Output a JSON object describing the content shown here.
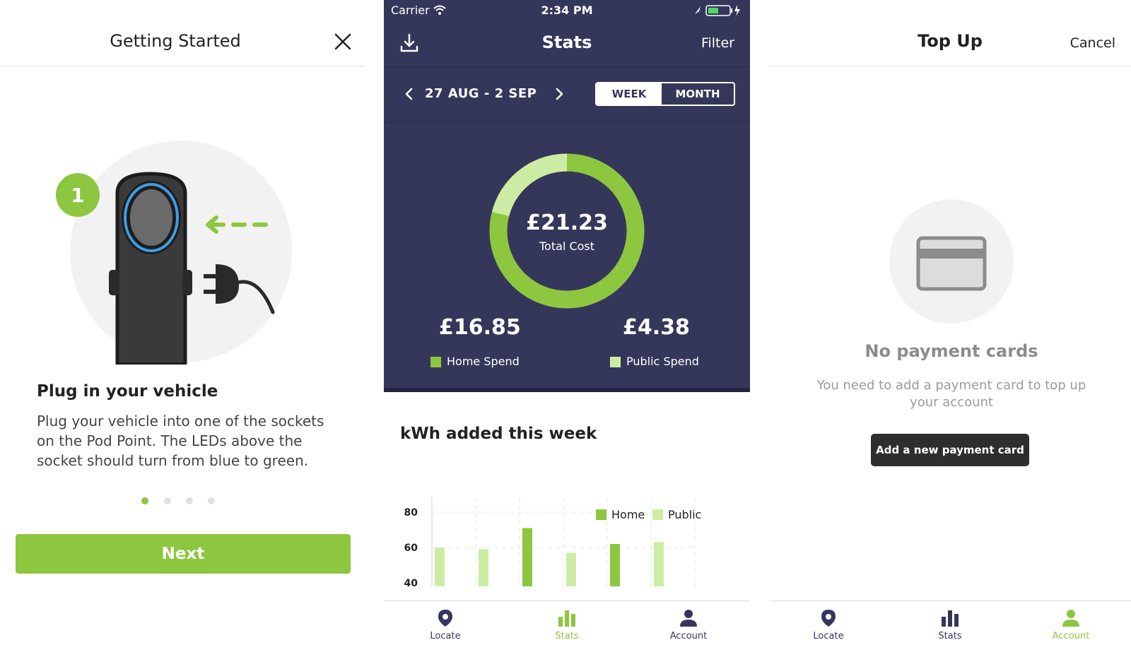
{
  "colors": {
    "brand_green": "#8dc63f",
    "light_green": "#cdeca3",
    "navy": "#35375a",
    "dark_button": "#2e2e2e"
  },
  "getting_started": {
    "title": "Getting Started",
    "close_icon": "close-icon",
    "step_badge": "1",
    "step_title": "Plug in your vehicle",
    "step_body": "Plug your vehicle into one of the sockets on the Pod Point. The LEDs above the socket should turn from blue to green.",
    "pager": {
      "count": 4,
      "active": 0
    },
    "next_label": "Next"
  },
  "stats": {
    "status_bar": {
      "carrier": "Carrier",
      "time": "2:34 PM"
    },
    "title": "Stats",
    "filter_label": "Filter",
    "date_range": "27 AUG - 2 SEP",
    "segments": {
      "week": "WEEK",
      "month": "MONTH",
      "selected": "week"
    },
    "total": {
      "amount": "£21.23",
      "label": "Total Cost",
      "home_share": 0.79,
      "public_share": 0.21
    },
    "home": {
      "amount": "£16.85",
      "label": "Home Spend"
    },
    "public": {
      "amount": "£4.38",
      "label": "Public Spend"
    },
    "kwh_title": "kWh added this week",
    "tabs": [
      {
        "label": "Locate",
        "icon": "pin-icon",
        "active": false
      },
      {
        "label": "Stats",
        "icon": "bar-chart-icon",
        "active": true
      },
      {
        "label": "Account",
        "icon": "person-icon",
        "active": false
      }
    ]
  },
  "chart_data": {
    "type": "bar",
    "title": "kWh added this week",
    "y_ticks": [
      40,
      60,
      80
    ],
    "ylim_visible": [
      38,
      90
    ],
    "series": [
      {
        "name": "Home",
        "color": "#8dc63f",
        "points": [
          [
            2,
            71
          ],
          [
            4,
            62
          ]
        ]
      },
      {
        "name": "Public",
        "color": "#cdeca3",
        "points": [
          [
            0,
            60
          ],
          [
            1,
            59
          ],
          [
            3,
            57
          ],
          [
            5,
            63
          ]
        ]
      }
    ],
    "legend": [
      "Home",
      "Public"
    ],
    "legend_position": "top-right"
  },
  "top_up": {
    "title": "Top Up",
    "cancel_label": "Cancel",
    "card_icon": "credit-card-icon",
    "empty_title": "No payment cards",
    "empty_body": "You need to add a payment card to top up your account",
    "add_button": "Add a new payment card",
    "tabs": [
      {
        "label": "Locate",
        "icon": "pin-icon",
        "active": false
      },
      {
        "label": "Stats",
        "icon": "bar-chart-icon",
        "active": false
      },
      {
        "label": "Account",
        "icon": "person-icon",
        "active": true
      }
    ]
  }
}
